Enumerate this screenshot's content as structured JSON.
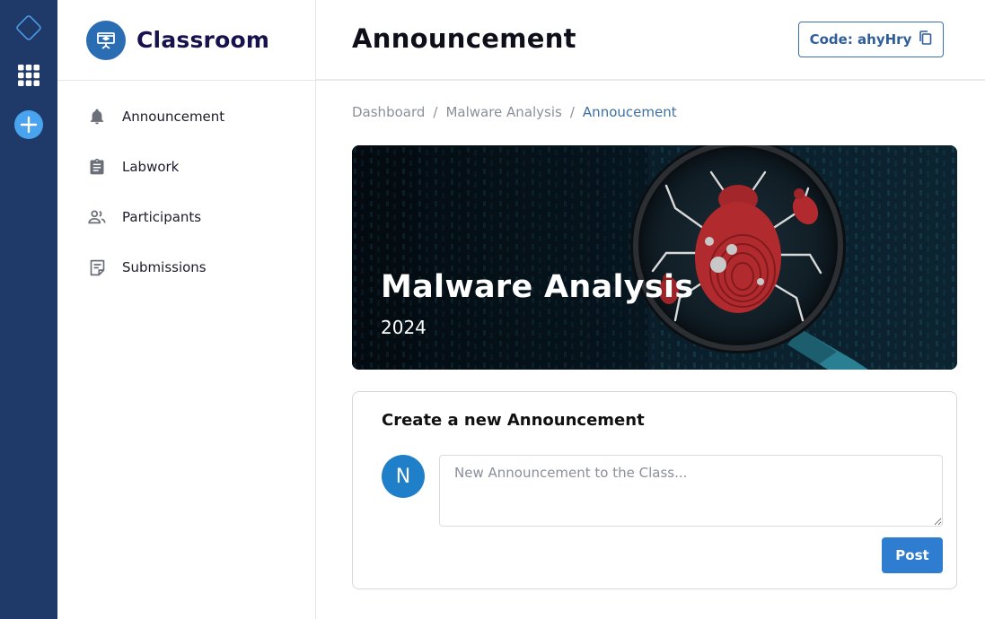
{
  "colors": {
    "rail": "#1f3a68",
    "brand_accent": "#2a6db3",
    "primary_button": "#2f7dd1",
    "avatar": "#1f80c9",
    "breadcrumb_active": "#3d6ea6"
  },
  "rail": {
    "icons": [
      "diamond-logo-icon",
      "apps-grid-icon",
      "add-circle-icon"
    ]
  },
  "brand": {
    "name": "Classroom",
    "icon": "classroom-presentation-icon"
  },
  "sidebar": {
    "items": [
      {
        "label": "Announcement",
        "icon": "bell-icon"
      },
      {
        "label": "Labwork",
        "icon": "clipboard-icon"
      },
      {
        "label": "Participants",
        "icon": "people-icon"
      },
      {
        "label": "Submissions",
        "icon": "note-icon"
      }
    ]
  },
  "header": {
    "title": "Announcement",
    "code_label": "Code: ahyHry",
    "code_icon": "copy-icon"
  },
  "breadcrumb": {
    "items": [
      "Dashboard",
      "Malware Analysis",
      "Annoucement"
    ],
    "separator": "/"
  },
  "banner": {
    "title": "Malware Analysis",
    "year": "2024"
  },
  "compose": {
    "title": "Create a new Announcement",
    "avatar_letter": "N",
    "placeholder": "New Announcement to the Class...",
    "value": "",
    "post_label": "Post"
  }
}
